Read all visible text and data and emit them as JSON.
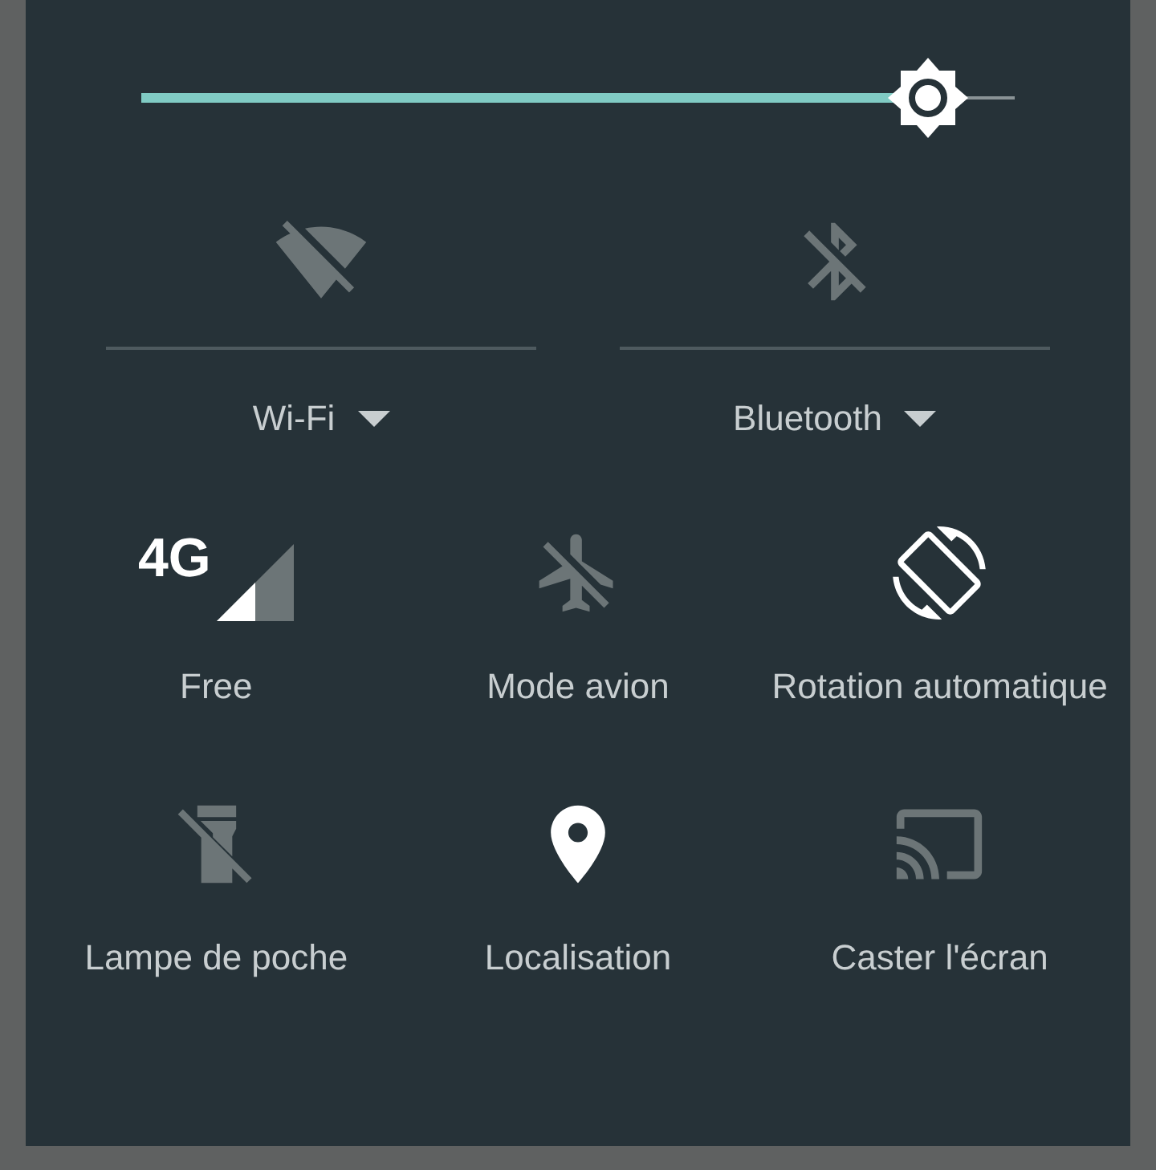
{
  "brightness": {
    "level": 0.9
  },
  "big_tiles": [
    {
      "label": "Wi-Fi",
      "kind": "wifi",
      "on": false
    },
    {
      "label": "Bluetooth",
      "kind": "bluetooth",
      "on": false
    }
  ],
  "tiles": [
    {
      "label": "Free",
      "kind": "cellular",
      "badge": "4G",
      "on": true
    },
    {
      "label": "Mode avion",
      "kind": "airplane",
      "on": false
    },
    {
      "label": "Rotation automatique",
      "kind": "rotation",
      "on": true
    },
    {
      "label": "Lampe de poche",
      "kind": "flashlight",
      "on": false
    },
    {
      "label": "Localisation",
      "kind": "location",
      "on": true
    },
    {
      "label": "Caster l'écran",
      "kind": "cast",
      "on": false
    }
  ]
}
